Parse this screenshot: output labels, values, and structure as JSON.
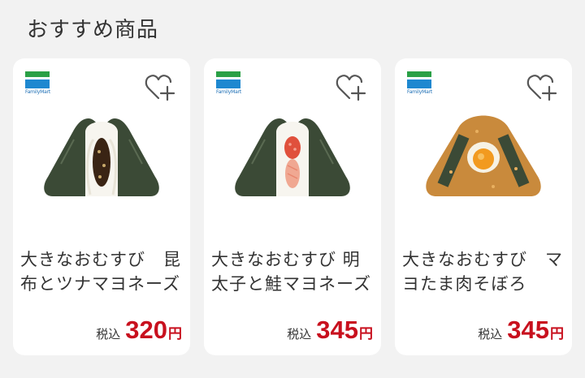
{
  "section": {
    "title": "おすすめ商品"
  },
  "brand": {
    "name": "FamilyMart",
    "green": "#2aa046",
    "blue": "#1e88d0"
  },
  "accent": {
    "price_color": "#c8101e"
  },
  "products": [
    {
      "name": "大きなおむすび　昆布とツナマヨネーズ",
      "tax_label": "税込",
      "price": "320",
      "currency": "円",
      "icon": "favorite-add-icon",
      "filling_color": "#3a2414",
      "wrap": "nori"
    },
    {
      "name": "大きなおむすび 明太子と鮭マヨネーズ",
      "tax_label": "税込",
      "price": "345",
      "currency": "円",
      "icon": "favorite-add-icon",
      "filling_color": "#e0503c",
      "wrap": "nori"
    },
    {
      "name": "大きなおむすび　マヨたま肉そぼろ",
      "tax_label": "税込",
      "price": "345",
      "currency": "円",
      "icon": "favorite-add-icon",
      "filling_color": "#f29a1f",
      "wrap": "soboro"
    }
  ]
}
